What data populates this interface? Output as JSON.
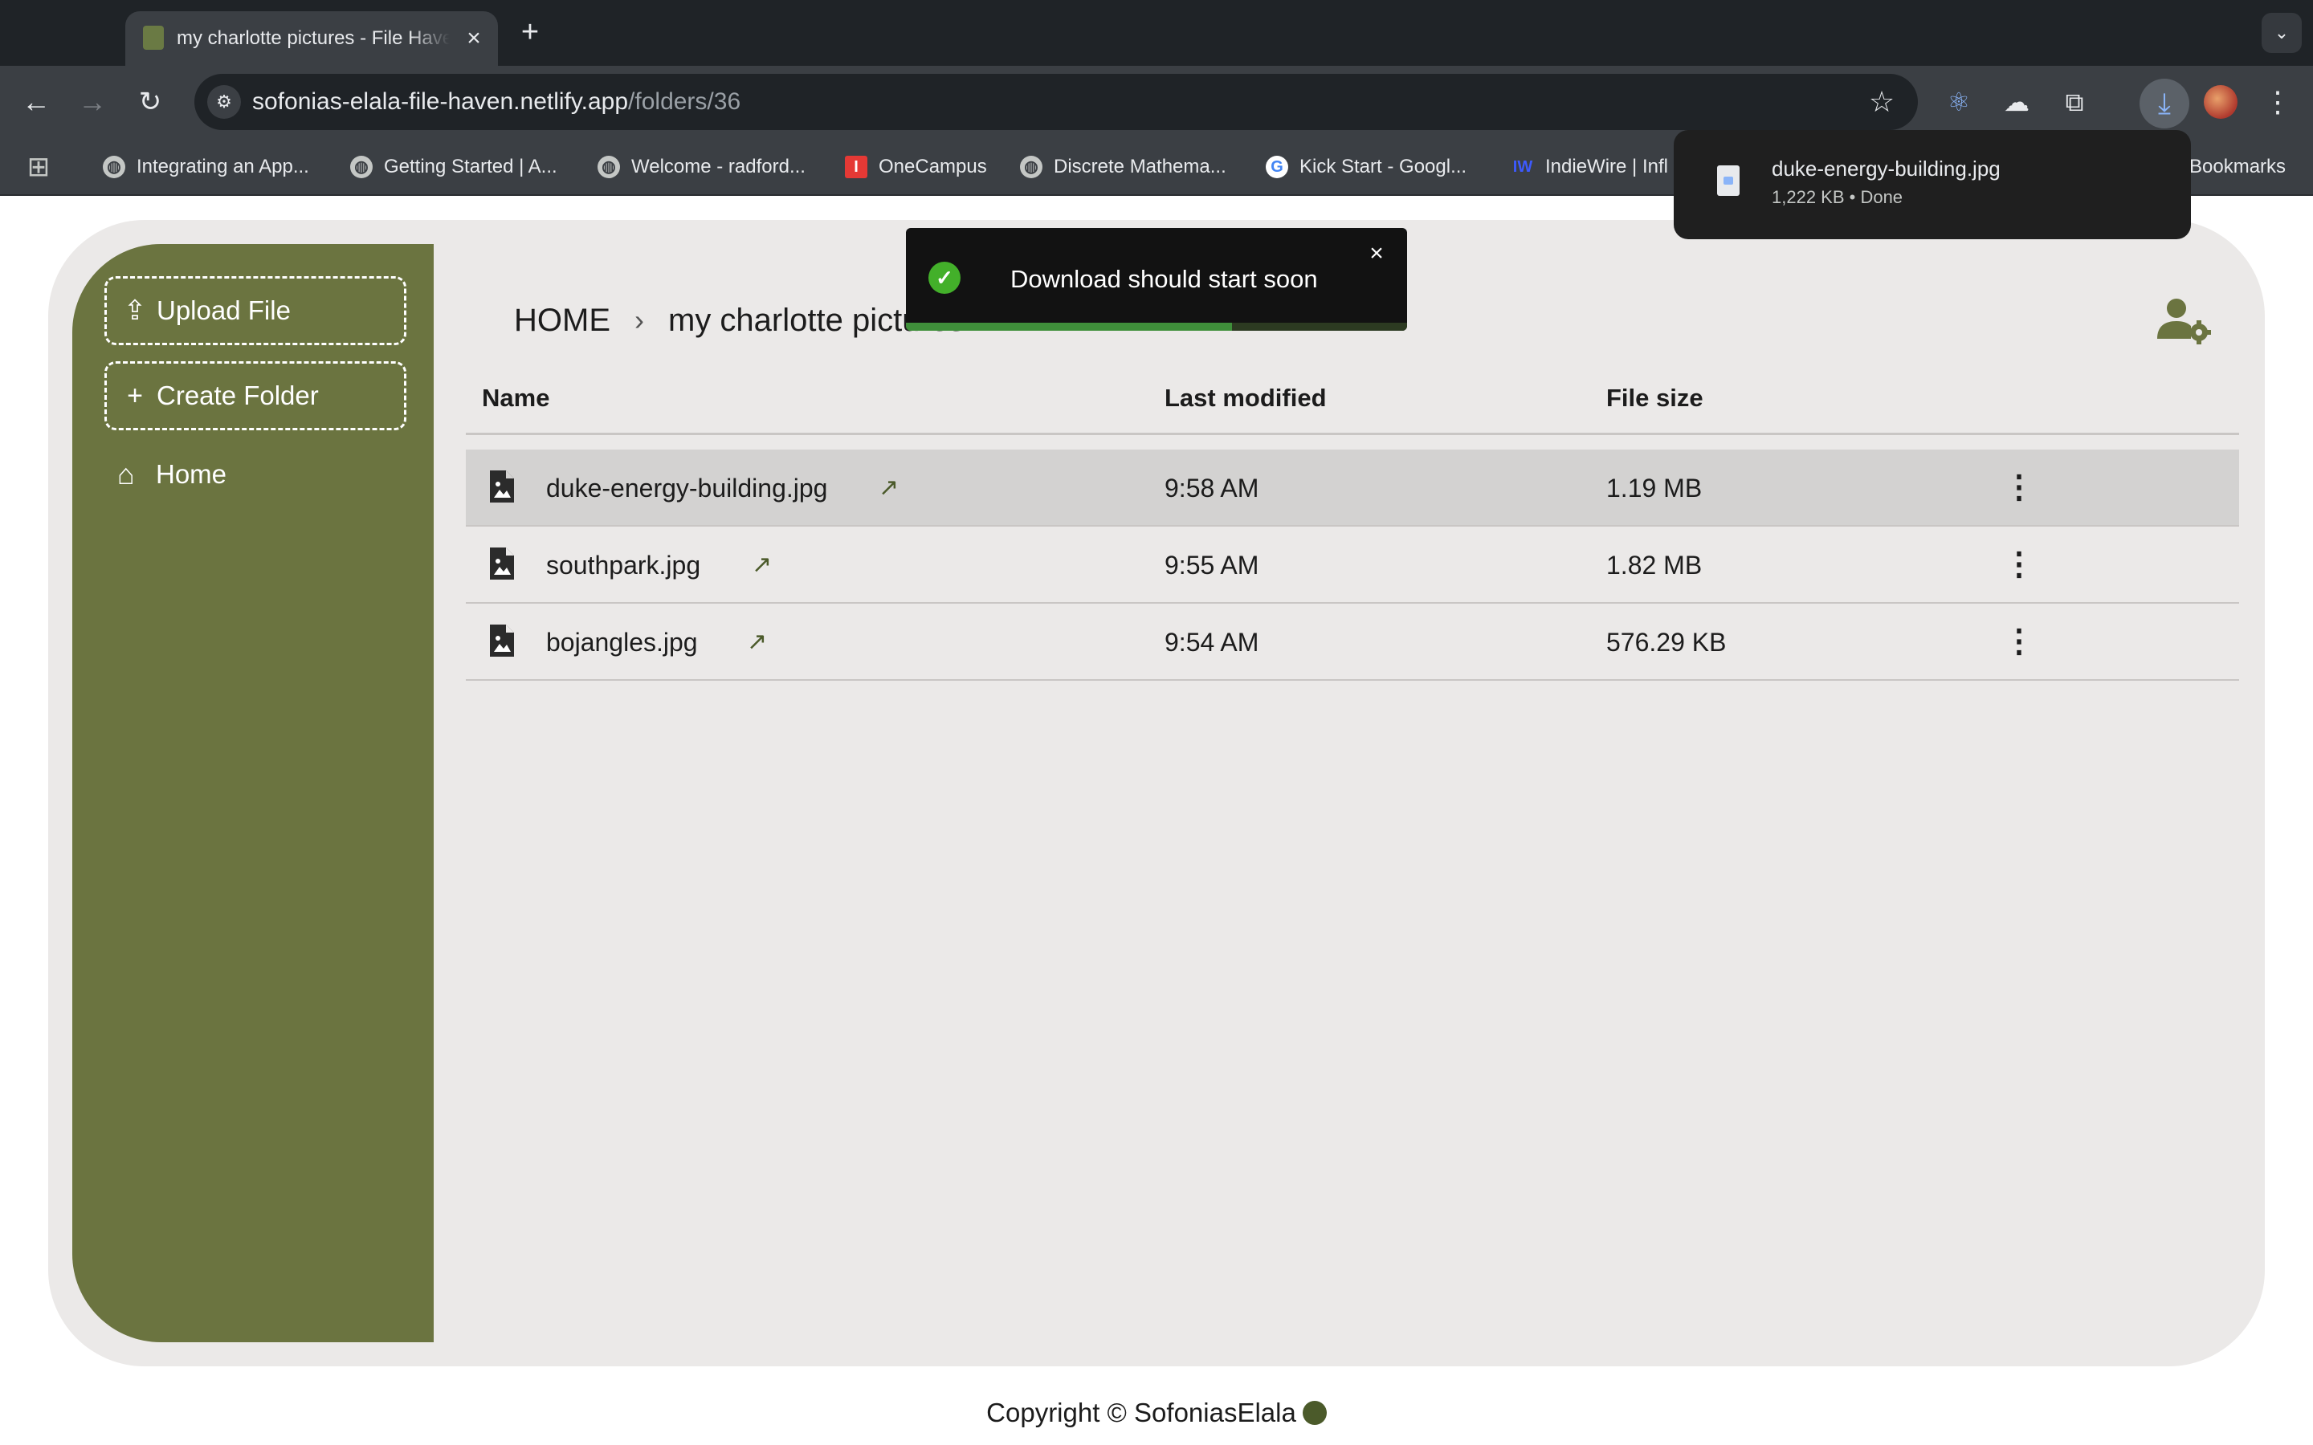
{
  "browser": {
    "tab_title": "my charlotte pictures - File Haven",
    "new_tab": "+",
    "url_host": "sofonias-elala-file-haven.netlify.app",
    "url_path": "/folders/36",
    "bookmarks": [
      {
        "label": "Integrating an App...",
        "icon": "globe-icon"
      },
      {
        "label": "Getting Started | A...",
        "icon": "globe-icon"
      },
      {
        "label": "Welcome - radford...",
        "icon": "globe-icon"
      },
      {
        "label": "OneCampus",
        "icon": "onecampus-icon"
      },
      {
        "label": "Discrete Mathema...",
        "icon": "globe-icon"
      },
      {
        "label": "Kick Start - Googl...",
        "icon": "google-icon"
      },
      {
        "label": "IndieWire | Infl",
        "icon": "indiewire-icon"
      }
    ],
    "all_bookmarks": "Bookmarks"
  },
  "download_bubble": {
    "file_name": "duke-energy-building.jpg",
    "status": "1,222 KB • Done"
  },
  "sidebar": {
    "upload_label": "Upload File",
    "create_folder_label": "Create Folder",
    "home_label": "Home"
  },
  "breadcrumb": {
    "root": "HOME",
    "current": "my charlotte pictures"
  },
  "table": {
    "headers": {
      "name": "Name",
      "modified": "Last modified",
      "size": "File size"
    },
    "rows": [
      {
        "name": "duke-energy-building.jpg",
        "modified": "9:58 AM",
        "size": "1.19 MB",
        "selected": true
      },
      {
        "name": "southpark.jpg",
        "modified": "9:55 AM",
        "size": "1.82 MB",
        "selected": false
      },
      {
        "name": "bojangles.jpg",
        "modified": "9:54 AM",
        "size": "576.29 KB",
        "selected": false
      }
    ]
  },
  "toast": {
    "message": "Download should start soon",
    "progress": 0.65
  },
  "footer": {
    "text": "Copyright © SofoniasElala"
  },
  "colors": {
    "accent": "#6b7440",
    "card_bg": "#ebe9e8",
    "toast_success": "#43b02a"
  }
}
